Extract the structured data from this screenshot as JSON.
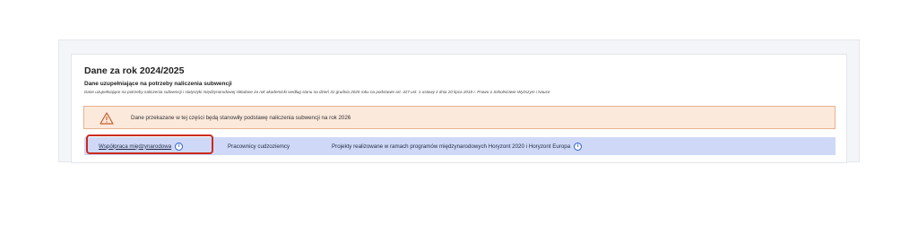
{
  "section": {
    "title": "Dane za rok 2024/2025",
    "subtitle": "Dane uzupełniające na potrzeby naliczenia subwencji",
    "description": "Dane uzupełniające na potrzeby naliczenia subwencji i statystyki międzynarodowej składane za rok akademicki według stanu na dzień 31 grudnia 2025 roku na podstawie art. 427 ust. 1 ustawy z dnia 20 lipca 2018 r. Prawo o Szkolnictwie Wyższym i Nauce"
  },
  "warning": {
    "icon": "warning-triangle-icon",
    "text": "Dane przekazane w tej części będą stanowiły podstawę naliczenia subwencji na rok 2026"
  },
  "tabs": [
    {
      "label": "Współpraca międzynarodowa",
      "info_icon": "i",
      "active": true
    },
    {
      "label": "Pracownicy cudzoziemcy"
    },
    {
      "label": "Projekty realizowane w ramach programów międzynarodowych Horyzont 2020 i Horyzont Europa",
      "info_icon": "i"
    }
  ],
  "colors": {
    "tab_bar": "#cfd9f7",
    "warning_bg": "#fbe9dc",
    "warning_border": "#e7b28f",
    "highlight": "#cc2a1c",
    "info_icon": "#2d5fd6"
  }
}
